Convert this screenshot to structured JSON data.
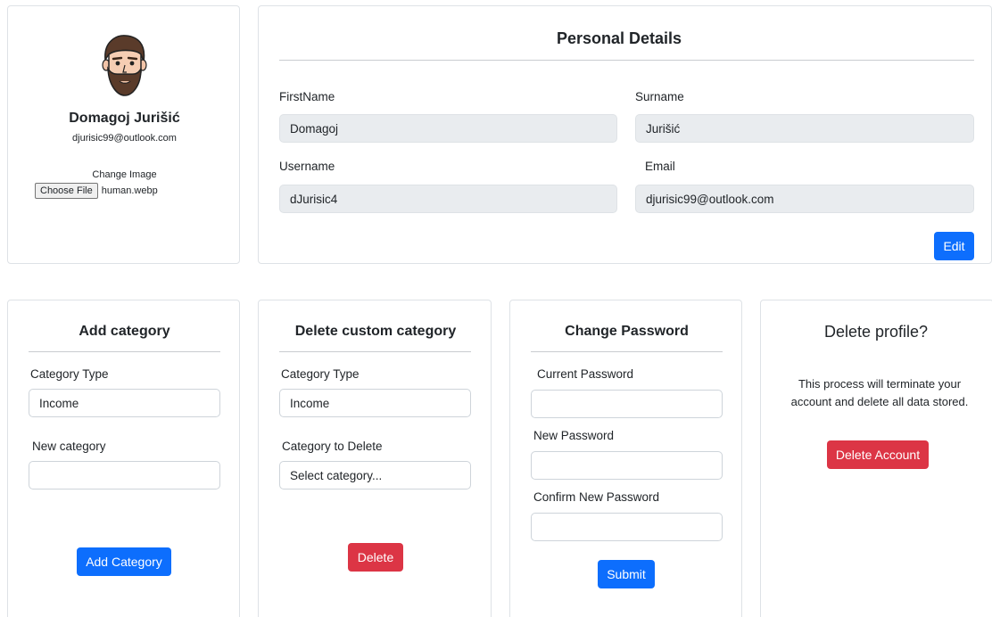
{
  "profile": {
    "name": "Domagoj Jurišić",
    "email": "djurisic99@outlook.com",
    "change_image_label": "Change Image",
    "choose_file_label": "Choose File",
    "file_name": "human.webp"
  },
  "personal_details": {
    "title": "Personal Details",
    "firstname_label": "FirstName",
    "firstname_value": "Domagoj",
    "surname_label": "Surname",
    "surname_value": "Jurišić",
    "username_label": "Username",
    "username_value": "dJurisic4",
    "email_label": "Email",
    "email_value": "djurisic99@outlook.com",
    "edit_label": "Edit"
  },
  "add_category": {
    "title": "Add category",
    "type_label": "Category Type",
    "type_value": "Income",
    "new_label": "New category",
    "new_value": "",
    "button_label": "Add Category"
  },
  "delete_category": {
    "title": "Delete custom category",
    "type_label": "Category Type",
    "type_value": "Income",
    "delete_label": "Category to Delete",
    "delete_value": "Select category...",
    "button_label": "Delete"
  },
  "change_password": {
    "title": "Change Password",
    "current_label": "Current Password",
    "new_label": "New Password",
    "confirm_label": "Confirm New Password",
    "button_label": "Submit"
  },
  "delete_profile": {
    "title": "Delete profile?",
    "description": "This process will terminate your account and delete all data stored.",
    "button_label": "Delete Account"
  },
  "colors": {
    "primary": "#0d6efd",
    "danger": "#dc3545",
    "disabled_input": "#e9ecef",
    "border": "#dee2e6"
  },
  "icons": {
    "avatar": "bearded-man-avatar"
  }
}
